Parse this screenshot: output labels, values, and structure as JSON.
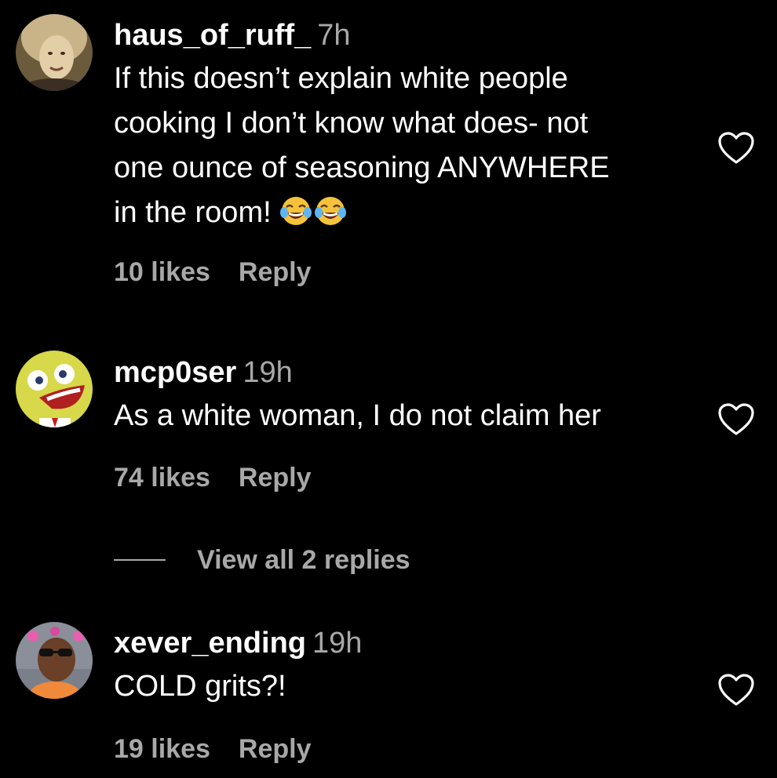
{
  "comments": [
    {
      "username": "haus_of_ruff_",
      "time": "7h",
      "text_lines": [
        "If this doesn’t explain white people",
        "cooking I don’t know what does- not",
        "one ounce of seasoning ANYWHERE",
        "in the room!"
      ],
      "emoji": "😂😂",
      "likes": "10 likes",
      "reply_label": "Reply"
    },
    {
      "username": "mcp0ser",
      "time": "19h",
      "text_lines": [
        "As a white woman, I do not claim her"
      ],
      "likes": "74 likes",
      "reply_label": "Reply",
      "view_replies": "View all 2 replies"
    },
    {
      "username": "xever_ending",
      "time": "19h",
      "text_lines": [
        "COLD grits?!"
      ],
      "likes": "19 likes",
      "reply_label": "Reply"
    }
  ],
  "icons": {
    "like": "heart-outline-icon",
    "emoji": "face-with-tears-of-joy"
  },
  "colors": {
    "background": "#000000",
    "primary_text": "#ffffff",
    "secondary_text": "#a8a8a8"
  }
}
